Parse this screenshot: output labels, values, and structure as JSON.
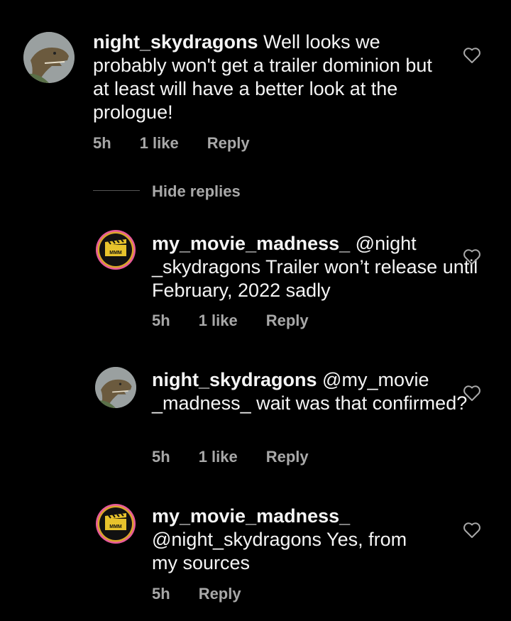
{
  "comments": [
    {
      "username": "night_skydragons",
      "text": " Well looks we probably won't get a trailer dominion but at least will have a better look at the prologue!",
      "time": "5h",
      "likes": "1 like",
      "reply": "Reply",
      "avatar": "dinosaur-avatar"
    },
    {
      "username": "my_movie_madness_",
      "text": " @night _skydragons Trailer won’t release until February, 2022 sadly",
      "time": "5h",
      "likes": "1 like",
      "reply": "Reply",
      "avatar": "clapperboard-avatar"
    },
    {
      "username": "night_skydragons",
      "text": " @my_movie _madness_ wait was that confirmed?",
      "time": "5h",
      "likes": "1 like",
      "reply": "Reply",
      "avatar": "dinosaur-avatar"
    },
    {
      "username": "my_movie_madness_",
      "text": " @night_skydragons Yes, from my sources",
      "time": "5h",
      "reply": "Reply",
      "avatar": "clapperboard-avatar"
    }
  ],
  "hide_replies": "Hide replies",
  "avatar_logo_text": "MMM",
  "colors": {
    "background": "#000000",
    "text": "#f5f5f5",
    "meta": "#a8a8a8",
    "ring": "#d9a52a"
  },
  "icons": {
    "like": "heart-outline-icon"
  }
}
